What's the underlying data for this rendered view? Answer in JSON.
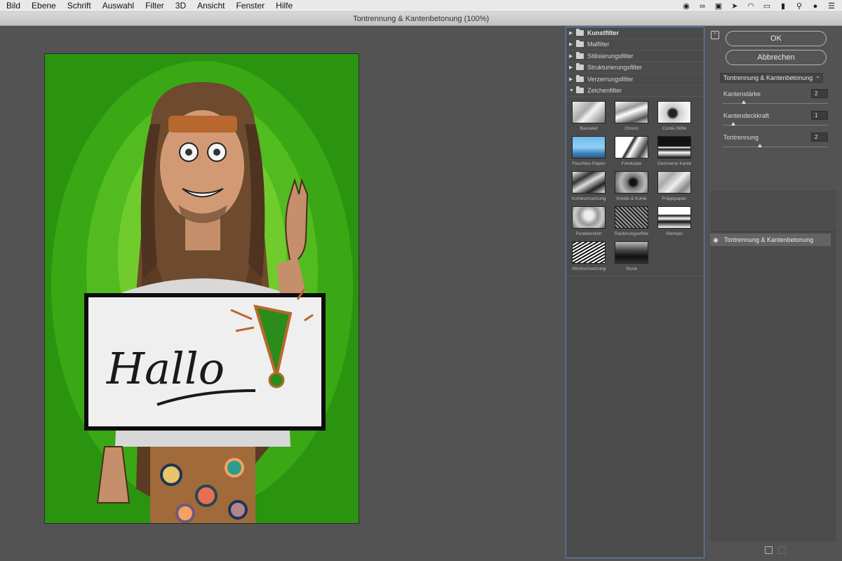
{
  "menubar": {
    "items": [
      "Bild",
      "Ebene",
      "Schrift",
      "Auswahl",
      "Filter",
      "3D",
      "Ansicht",
      "Fenster",
      "Hilfe"
    ],
    "status_icons": [
      "record-icon",
      "creative-cloud-icon",
      "screen-icon",
      "location-icon",
      "wifi-icon",
      "airplay-icon",
      "battery-icon",
      "search-icon",
      "user-icon",
      "list-icon"
    ]
  },
  "dialog": {
    "title": "Tontrennung & Kantenbetonung (100%)"
  },
  "preview": {
    "sign_text": "Hallo"
  },
  "gallery": {
    "categories": [
      {
        "label": "Kunstfilter",
        "expanded": false,
        "bold": true
      },
      {
        "label": "Malfilter",
        "expanded": false
      },
      {
        "label": "Stilisierungsfilter",
        "expanded": false
      },
      {
        "label": "Strukturierungsfilter",
        "expanded": false
      },
      {
        "label": "Verzerrungsfilter",
        "expanded": false
      },
      {
        "label": "Zeichenfilter",
        "expanded": true
      }
    ],
    "thumbnails": [
      "Basrelief",
      "Chrom",
      "Conté-Stifte",
      "Feuchtes Papier",
      "Fotokopie",
      "Gerissene Kanten",
      "Kohleumsetzung",
      "Kreide & Kohle",
      "Prägepapier",
      "Punktierstich",
      "Rasterungseffekt",
      "Stempel",
      "Strichumsetzung",
      "Stuck"
    ]
  },
  "settings": {
    "ok_label": "OK",
    "cancel_label": "Abbrechen",
    "filter_select": "Tontrennung & Kantenbetonung",
    "params": [
      {
        "label": "Kantenstärke",
        "value": "2",
        "level": 0.2
      },
      {
        "label": "Kantendeckkraft",
        "value": "1",
        "level": 0.1
      },
      {
        "label": "Tontrennung",
        "value": "2",
        "level": 0.35
      }
    ],
    "layer": {
      "name": "Tontrennung & Kantenbetonung"
    }
  },
  "colors": {
    "accent_border": "#5a89c9",
    "background_green": "#2e9d12",
    "headband": "#b8672e"
  }
}
